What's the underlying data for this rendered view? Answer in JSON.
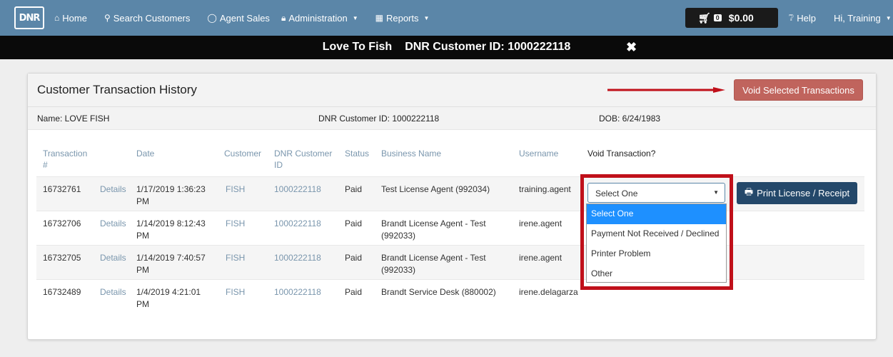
{
  "nav": {
    "logo": "DNR",
    "home": "Home",
    "search_customers": "Search Customers",
    "agent_sales": "Agent Sales",
    "administration": "Administration",
    "reports": "Reports",
    "cart_count": "0",
    "cart_total": "$0.00",
    "help": "Help",
    "user": "Hi, Training"
  },
  "customer_bar": {
    "name": "Love To Fish",
    "customer_id": "DNR Customer ID: 1000222118"
  },
  "panel": {
    "title": "Customer Transaction History",
    "void_button": "Void Selected Transactions",
    "name": "Name: LOVE FISH",
    "dnr_id": "DNR Customer ID: 1000222118",
    "dob": "DOB: 6/24/1983"
  },
  "table": {
    "headers": {
      "txn": "Transaction #",
      "date": "Date",
      "customer": "Customer",
      "dnr_id": "DNR Customer ID",
      "status": "Status",
      "business": "Business Name",
      "username": "Username",
      "void": "Void Transaction?"
    },
    "rows": [
      {
        "txn": "16732761",
        "details": "Details",
        "date": "1/17/2019 1:36:23 PM",
        "customer": "FISH",
        "dnr_id": "1000222118",
        "status": "Paid",
        "business": "Test License Agent (992034)",
        "username": "training.agent"
      },
      {
        "txn": "16732706",
        "details": "Details",
        "date": "1/14/2019 8:12:43 PM",
        "customer": "FISH",
        "dnr_id": "1000222118",
        "status": "Paid",
        "business": "Brandt License Agent - Test (992033)",
        "username": "irene.agent"
      },
      {
        "txn": "16732705",
        "details": "Details",
        "date": "1/14/2019 7:40:57 PM",
        "customer": "FISH",
        "dnr_id": "1000222118",
        "status": "Paid",
        "business": "Brandt License Agent - Test (992033)",
        "username": "irene.agent"
      },
      {
        "txn": "16732489",
        "details": "Details",
        "date": "1/4/2019 4:21:01 PM",
        "customer": "FISH",
        "dnr_id": "1000222118",
        "status": "Paid",
        "business": "Brandt Service Desk (880002)",
        "username": "irene.delagarza"
      }
    ]
  },
  "void_select": {
    "value": "Select One",
    "options": [
      "Select One",
      "Payment Not Received / Declined",
      "Printer Problem",
      "Other"
    ]
  },
  "print_button": "Print License / Receipt",
  "colors": {
    "navbar": "#5b86a8",
    "void_button": "#c0645d",
    "print_button": "#24486a",
    "highlight": "#c0101a"
  }
}
